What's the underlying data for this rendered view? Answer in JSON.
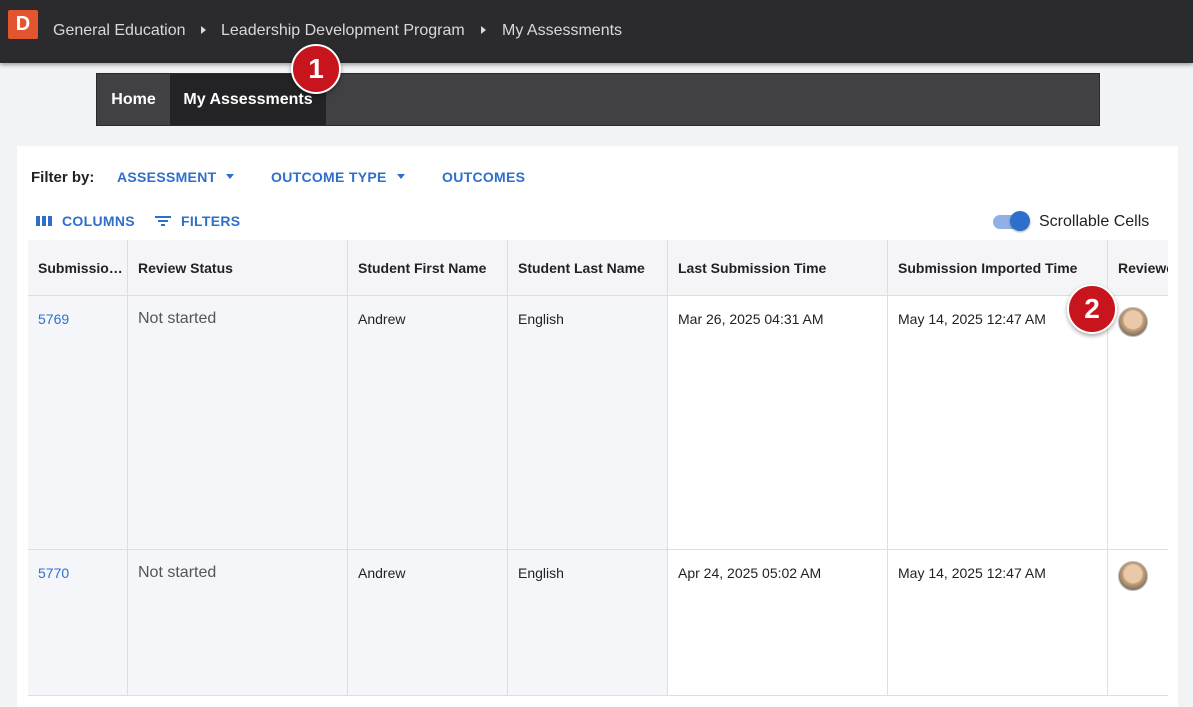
{
  "breadcrumb": {
    "logo_letter": "D",
    "items": [
      "General Education",
      "Leadership Development Program",
      "My Assessments"
    ]
  },
  "subnav": {
    "tabs": [
      "Home",
      "My Assessments"
    ],
    "active": "My Assessments"
  },
  "callouts": [
    "1",
    "2"
  ],
  "filters": {
    "label": "Filter by:",
    "items": [
      "ASSESSMENT",
      "OUTCOME TYPE",
      "OUTCOMES"
    ]
  },
  "toolbar": {
    "columns_label": "COLUMNS",
    "filters_label": "FILTERS",
    "scrollable_label": "Scrollable Cells",
    "scrollable_on": true
  },
  "table": {
    "columns": [
      "Submissio…",
      "Review Status",
      "Student First Name",
      "Student Last Name",
      "Last Submission Time",
      "Submission Imported Time",
      "Reviewe"
    ],
    "rows": [
      {
        "id": "5769",
        "status": "Not started",
        "first": "Andrew",
        "last": "English",
        "last_sub": "Mar 26, 2025 04:31 AM",
        "imported": "May 14, 2025 12:47 AM",
        "reviewer": "reviewer-avatar"
      },
      {
        "id": "5770",
        "status": "Not started",
        "first": "Andrew",
        "last": "English",
        "last_sub": "Apr 24, 2025 05:02 AM",
        "imported": "May 14, 2025 12:47 AM",
        "reviewer": "reviewer-avatar"
      }
    ]
  },
  "colors": {
    "accent": "#2f6fcc",
    "topbar": "#2b2b2d",
    "logo": "#e2552f",
    "badge": "#c8141d"
  }
}
